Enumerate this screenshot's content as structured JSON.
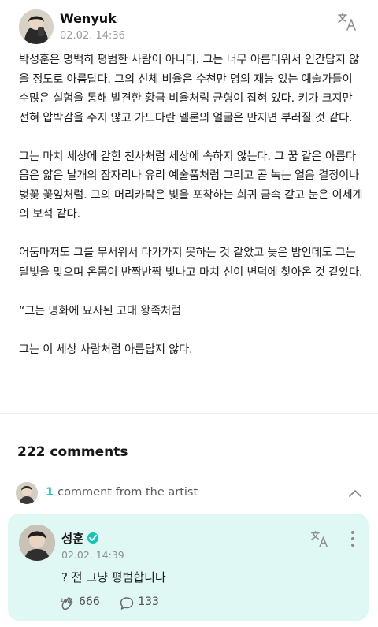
{
  "post": {
    "author": "Wenyuk",
    "time": "02.02. 14:36",
    "paragraphs": [
      "박성훈은 명백히 평범한 사람이 아니다. 그는 너무 아름다워서 인간답지 않을 정도로 아름답다. 그의 신체 비율은 수천만 명의 재능 있는 예술가들이 수많은 실험을 통해 발견한 황금 비율처럼 균형이 잡혀 있다. 키가 크지만 전혀 압박감을 주지 않고 가느다란 멜론의 얼굴은 만지면 부러질 것 같다.",
      "그는 마치 세상에 갇힌 천사처럼 세상에 속하지 않는다. 그 꿈 같은 아름다움은 얇은 날개의 잠자리나 유리 예술품처럼 그리고 곧 녹는 얼음 결정이나 벚꽃 꽃잎처럼. 그의 머리카락은 빛을 포착하는 희귀 금속 같고 눈은 이세계의 보석 같다.",
      "어둠마저도 그를 무서워서 다가가지 못하는 것 같았고 늦은 밤인데도 그는 달빛을 맞으며 온몸이 반짝반짝 빛나고 마치 신이 변덕에 찾아온 것 같았다.",
      "“그는 명화에 묘사된 고대 왕족처럼",
      "그는 이 세상 사람처럼 아름답지 않다."
    ]
  },
  "comments": {
    "count_label": "222 comments",
    "artist_count": "1",
    "artist_label": "comment from the artist"
  },
  "artist_comment": {
    "name": "성훈",
    "time": "02.02. 14:39",
    "text": "? 전 그냥 평범합니다",
    "likes": "666",
    "replies": "133"
  },
  "icons": {
    "translate": "translate-icon",
    "verified": "verified-badge-icon",
    "chevron": "chevron-up-icon",
    "more": "more-vertical-icon",
    "like": "cheer-hand-icon",
    "reply": "speech-bubble-icon"
  },
  "colors": {
    "accent": "#16c3b4",
    "artist_card_bg": "#dff8f3"
  }
}
